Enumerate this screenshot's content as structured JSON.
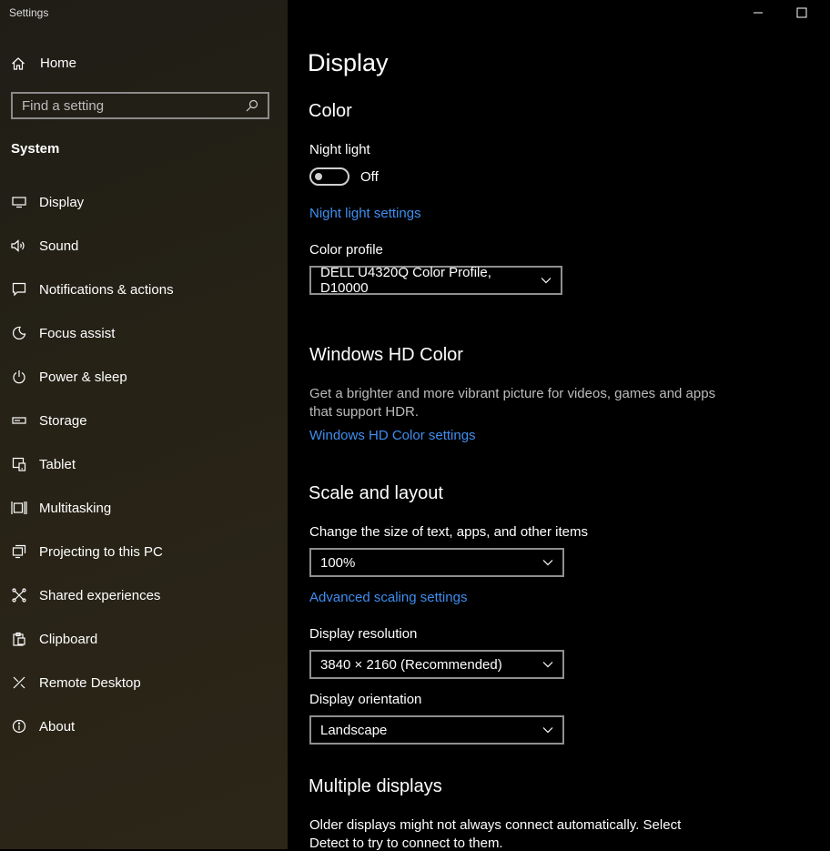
{
  "window": {
    "title": "Settings"
  },
  "sidebar": {
    "home_label": "Home",
    "search_placeholder": "Find a setting",
    "section_title": "System",
    "items": [
      {
        "label": "Display",
        "icon": "display-icon"
      },
      {
        "label": "Sound",
        "icon": "sound-icon"
      },
      {
        "label": "Notifications & actions",
        "icon": "notifications-icon"
      },
      {
        "label": "Focus assist",
        "icon": "focus-assist-icon"
      },
      {
        "label": "Power & sleep",
        "icon": "power-icon"
      },
      {
        "label": "Storage",
        "icon": "storage-icon"
      },
      {
        "label": "Tablet",
        "icon": "tablet-icon"
      },
      {
        "label": "Multitasking",
        "icon": "multitasking-icon"
      },
      {
        "label": "Projecting to this PC",
        "icon": "projecting-icon"
      },
      {
        "label": "Shared experiences",
        "icon": "shared-experiences-icon"
      },
      {
        "label": "Clipboard",
        "icon": "clipboard-icon"
      },
      {
        "label": "Remote Desktop",
        "icon": "remote-desktop-icon"
      },
      {
        "label": "About",
        "icon": "about-icon"
      }
    ]
  },
  "main": {
    "page_title": "Display",
    "color": {
      "heading": "Color",
      "night_light_label": "Night light",
      "night_light_state": "Off",
      "night_light_link": "Night light settings",
      "color_profile_label": "Color profile",
      "color_profile_value": "DELL U4320Q Color Profile, D10000"
    },
    "hd_color": {
      "heading": "Windows HD Color",
      "description_line1": "Get a brighter and more vibrant picture for videos, games and apps",
      "description_line2": "that support HDR.",
      "link": "Windows HD Color settings"
    },
    "scale": {
      "heading": "Scale and layout",
      "size_label": "Change the size of text, apps, and other items",
      "size_value": "100%",
      "advanced_link": "Advanced scaling settings",
      "resolution_label": "Display resolution",
      "resolution_value": "3840 × 2160 (Recommended)",
      "orientation_label": "Display orientation",
      "orientation_value": "Landscape"
    },
    "multiple": {
      "heading": "Multiple displays",
      "description_line1": "Older displays might not always connect automatically. Select",
      "description_line2": "Detect to try to connect to them."
    }
  },
  "colors": {
    "link": "#3f8ef0",
    "background": "#000000",
    "sidebar": "#262216"
  }
}
